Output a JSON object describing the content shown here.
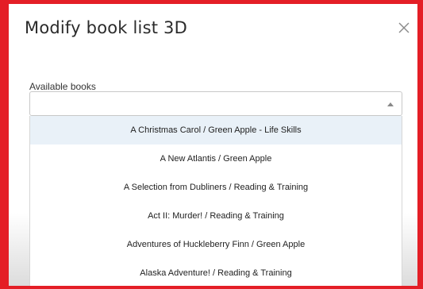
{
  "modal": {
    "title": "Modify book list 3D",
    "close_icon": "close-x-icon"
  },
  "field": {
    "label": "Available books",
    "selected_value": "",
    "caret_icon": "caret-up-icon"
  },
  "dropdown": {
    "options": [
      "A Christmas Carol / Green Apple - Life Skills",
      "A New Atlantis / Green Apple",
      "A Selection from Dubliners / Reading & Training",
      "Act II: Murder! / Reading & Training",
      "Adventures of Huckleberry Finn / Green Apple",
      "Alaska Adventure! / Reading & Training"
    ],
    "highlighted_index": 0
  },
  "colors": {
    "frame": "#e41e26",
    "highlight": "#e9f1f8"
  }
}
